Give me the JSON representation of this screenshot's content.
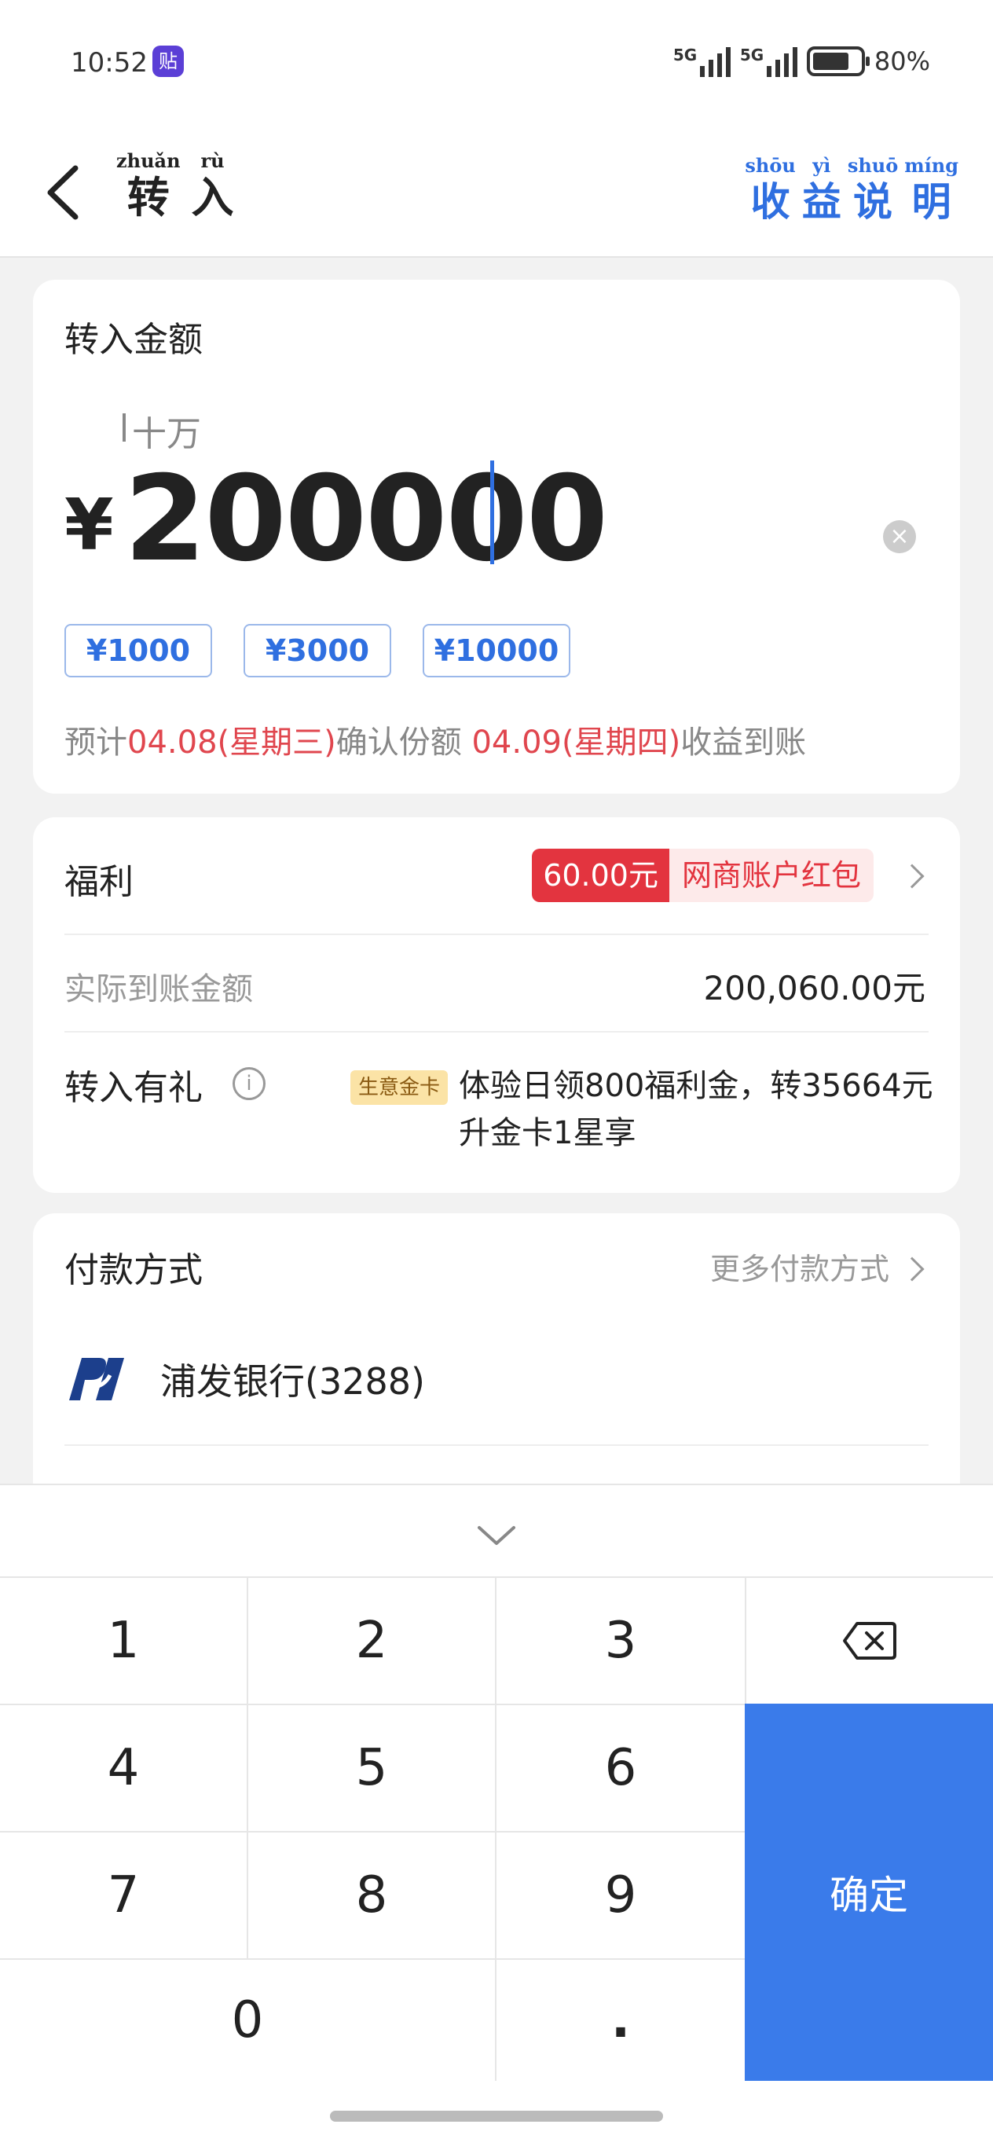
{
  "status": {
    "time": "10:52",
    "app_icon_text": "贴",
    "signal1": "5G",
    "signal2": "5G",
    "battery": "80%"
  },
  "header": {
    "title_pinyin": [
      "zhuǎn",
      "rù"
    ],
    "title_chars": [
      "转",
      "入"
    ],
    "help_pinyin": [
      "shōu",
      "yì",
      "shuō",
      "míng"
    ],
    "help_chars": [
      "收",
      "益",
      "说",
      "明"
    ]
  },
  "amount_card": {
    "label": "转入金额",
    "unit_hint": "十万",
    "currency": "¥",
    "amount": "200000",
    "chips": [
      "¥1000",
      "¥3000",
      "¥10000"
    ],
    "estimate": {
      "prefix": "预计",
      "confirm_date": "04.08(星期三)",
      "middle": "确认份额 ",
      "earn_date": "04.09(星期四)",
      "suffix": "收益到账"
    }
  },
  "welfare_card": {
    "label": "福利",
    "badge_amount": "60.00元",
    "badge_text": "网商账户红包",
    "arrival_label": "实际到账金额",
    "arrival_value": "200,060.00元",
    "gift_label": "转入有礼",
    "gift_tag": "生意金卡",
    "gift_text": "体验日领800福利金，转35664元升金卡1星享"
  },
  "pay_card": {
    "label": "付款方式",
    "more": "更多付款方式",
    "bank": "浦发银行(3288)"
  },
  "keyboard": {
    "keys": [
      "1",
      "2",
      "3",
      "4",
      "5",
      "6",
      "7",
      "8",
      "9",
      "0",
      "."
    ],
    "confirm": "确定"
  },
  "colors": {
    "accent": "#3a7bea",
    "red": "#e3343f",
    "link_blue": "#2f6fe0"
  }
}
